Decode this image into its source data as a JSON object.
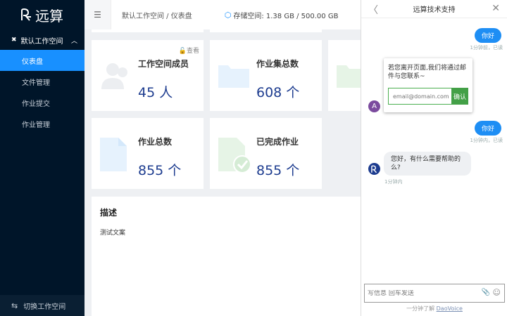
{
  "app": {
    "logo_text": "远算"
  },
  "sidebar": {
    "workspace_menu": "默认工作空间",
    "items": [
      {
        "label": "仪表盘",
        "active": true
      },
      {
        "label": "文件管理",
        "active": false
      },
      {
        "label": "作业提交",
        "active": false
      },
      {
        "label": "作业管理",
        "active": false
      }
    ],
    "switch_label": "切换工作空间"
  },
  "header": {
    "breadcrumb": "默认工作空间 / 仪表盘",
    "storage": "存储空间: 1.38 GB / 500.00 GB"
  },
  "dashboard": {
    "view_link": "查看",
    "cards": [
      {
        "title": "工作空间成员",
        "value": "45 人",
        "icon": "users-icon"
      },
      {
        "title": "作业集总数",
        "value": "608 个",
        "icon": "folder-icon"
      },
      {
        "title": "作业总数",
        "value": "855 个",
        "icon": "file-icon"
      },
      {
        "title": "已完成作业",
        "value": "855 个",
        "icon": "file-check-icon"
      }
    ],
    "description": {
      "heading": "描述",
      "text": "测试文案"
    }
  },
  "chat": {
    "title": "远算技术支持",
    "messages": [
      {
        "text": "你好",
        "meta": "1分钟前，已读"
      },
      {
        "text": "你好",
        "meta": "1分钟内，已读"
      }
    ],
    "email_prompt": "若您离开页面,我们将通过邮件与您联系~",
    "email_placeholder": "email@domain.com",
    "email_confirm": "确认",
    "agent_avatar_letter": "A",
    "reply": {
      "text": "您好，有什么需要帮助的么?",
      "meta": "1分钟内"
    },
    "input_placeholder": "写信息 回车发送",
    "powered_prefix": "一分钟了解",
    "powered_link": "DaoVoice"
  },
  "colors": {
    "accent": "#1890ff",
    "sidebar_bg": "#001529",
    "value_blue": "#1d3c8f",
    "confirm_green": "#43a047"
  }
}
